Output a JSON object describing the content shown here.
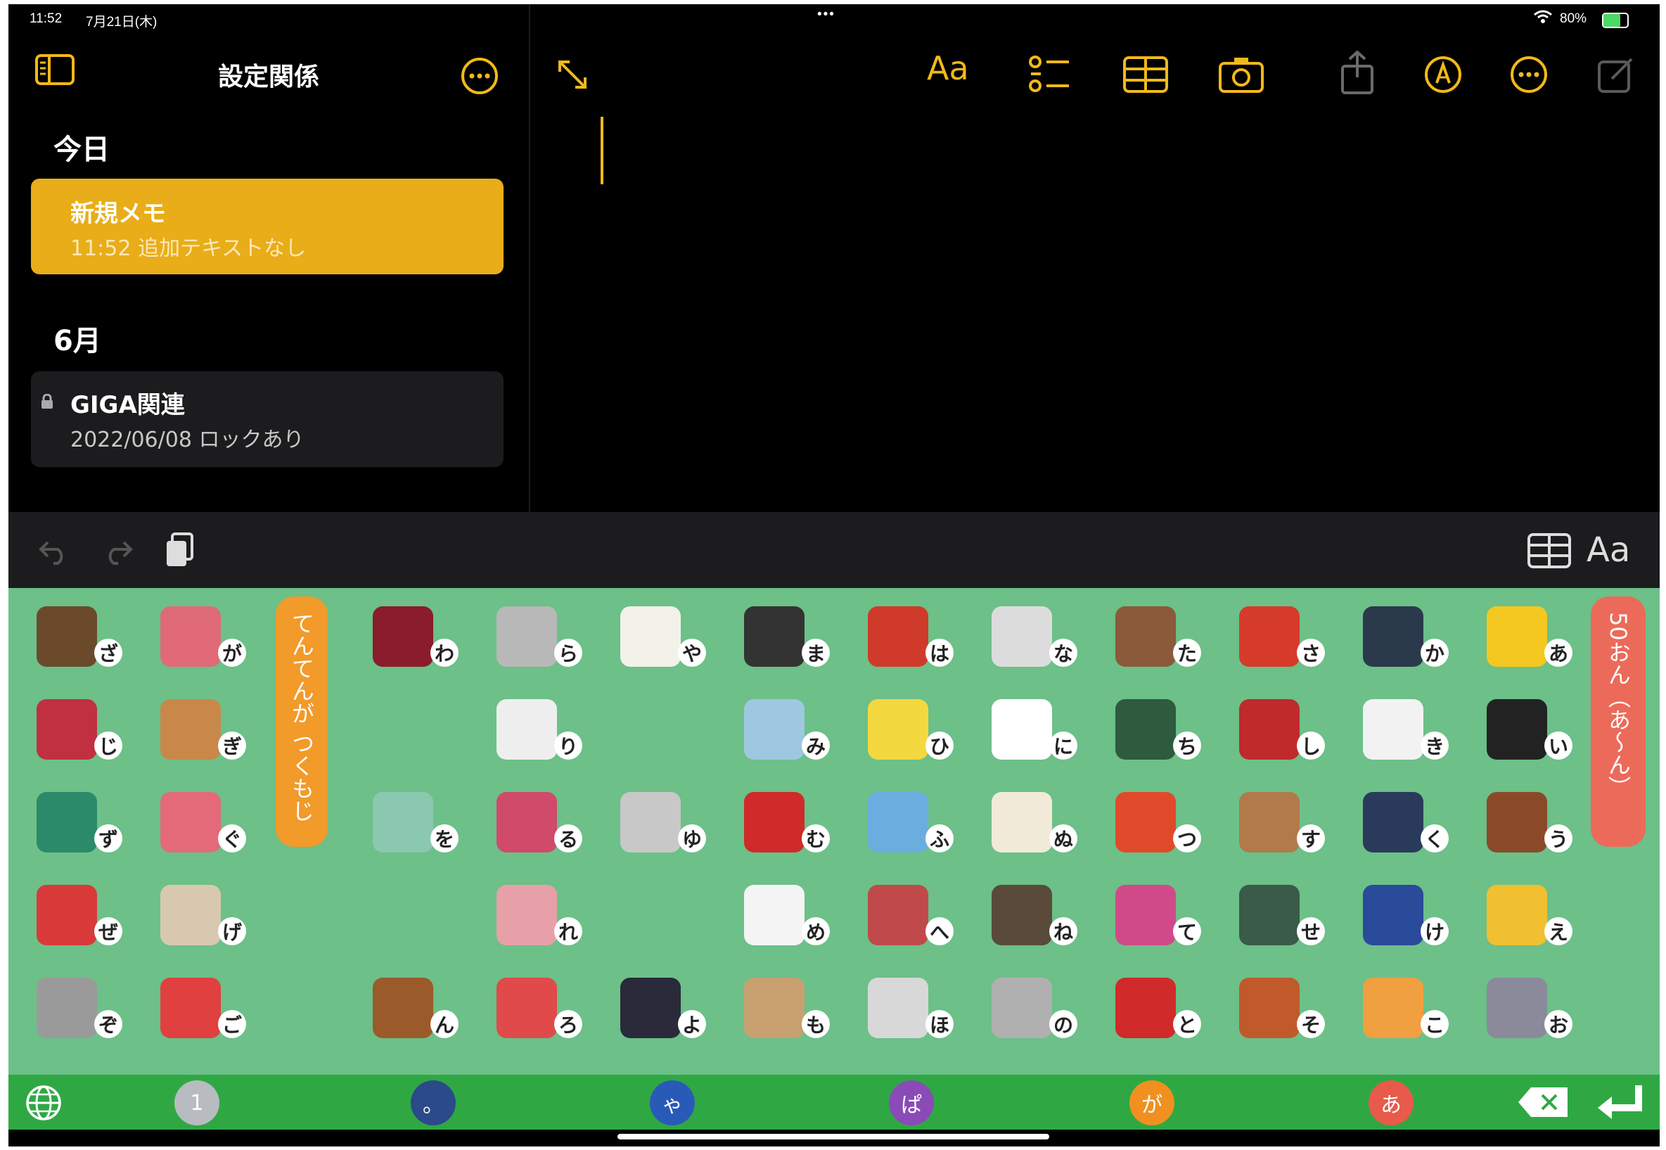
{
  "status": {
    "time": "11:52",
    "date": "7月21日(木)",
    "wifi": "wifi-icon",
    "battery": "80%"
  },
  "sidebar": {
    "title": "設定関係",
    "sections": [
      {
        "label": "今日",
        "notes": [
          {
            "title": "新規メモ",
            "subtitle": "11:52 追加テキストなし",
            "selected": true
          }
        ]
      },
      {
        "label": "6月",
        "notes": [
          {
            "title": "GIGA関連",
            "subtitle": "2022/06/08 ロックあり",
            "locked": true
          }
        ]
      }
    ]
  },
  "editor_toolbar": {
    "format_label": "Aa",
    "accent": "#f2b91a"
  },
  "input_toolbar": {
    "format_label": "Aa"
  },
  "keyboard": {
    "side_left": "てんてんが つくもじ",
    "side_right": "50おん（あ〜ん）",
    "bg": "#6cc088",
    "keys": [
      {
        "kana": "ざ",
        "pic": "rope-icon",
        "color": "#6b4a2c"
      },
      {
        "kana": "が",
        "pic": "purse-icon",
        "color": "#e06a78"
      },
      {
        "kana": "わ",
        "pic": "wine-icon",
        "color": "#8a1c2c"
      },
      {
        "kana": "ら",
        "pic": "robot-icon",
        "color": "#b8b8b8"
      },
      {
        "kana": "や",
        "pic": "goat-icon",
        "color": "#f2f2ea"
      },
      {
        "kana": "ま",
        "pic": "mic-icon",
        "color": "#333333"
      },
      {
        "kana": "は",
        "pic": "scissors-icon",
        "color": "#d03a2a"
      },
      {
        "kana": "な",
        "pic": "pot-icon",
        "color": "#dcdcdc"
      },
      {
        "kana": "た",
        "pic": "raccoon-icon",
        "color": "#8a5a3a"
      },
      {
        "kana": "さ",
        "pic": "santa-icon",
        "color": "#d63a2a"
      },
      {
        "kana": "か",
        "pic": "camera-icon",
        "color": "#2a3a4a"
      },
      {
        "kana": "あ",
        "pic": "duck-icon",
        "color": "#f4c820"
      },
      {
        "kana": "じ",
        "pic": "bicycle-icon",
        "color": "#c03040"
      },
      {
        "kana": "ぎ",
        "pic": "guitar-icon",
        "color": "#c8884a"
      },
      {
        "kana": "り",
        "pic": "airplane-icon",
        "color": "#eeeeee"
      },
      {
        "kana": "み",
        "pic": "faucet-icon",
        "color": "#9ec8e0"
      },
      {
        "kana": "ひ",
        "pic": "chick-icon",
        "color": "#f4d840"
      },
      {
        "kana": "に",
        "pic": "chicken-icon",
        "color": "#ffffff"
      },
      {
        "kana": "ち",
        "pic": "chalkboard-icon",
        "color": "#2e5a3e"
      },
      {
        "kana": "し",
        "pic": "train-icon",
        "color": "#c02a2a"
      },
      {
        "kana": "き",
        "pic": "ambulance-icon",
        "color": "#f2f2f2"
      },
      {
        "kana": "い",
        "pic": "dog-icon",
        "color": "#222222"
      },
      {
        "kana": "ず",
        "pic": "map-icon",
        "color": "#2a8a6a"
      },
      {
        "kana": "ぐ",
        "pic": "fish-icon",
        "color": "#e46a7a"
      },
      {
        "kana": "を",
        "pic": "painting-icon",
        "color": "#8ac8b0"
      },
      {
        "kana": "る",
        "pic": "gem-icon",
        "color": "#d04a6a"
      },
      {
        "kana": "ゆ",
        "pic": "ufo-icon",
        "color": "#c8c8c8"
      },
      {
        "kana": "む",
        "pic": "ladybug-icon",
        "color": "#d02a2a"
      },
      {
        "kana": "ふ",
        "pic": "flute-icon",
        "color": "#6aaee0"
      },
      {
        "kana": "ぬ",
        "pic": "embroidery-icon",
        "color": "#f2ead8"
      },
      {
        "kana": "つ",
        "pic": "blocks-icon",
        "color": "#e04a2a"
      },
      {
        "kana": "す",
        "pic": "shovel-icon",
        "color": "#b07a4a"
      },
      {
        "kana": "く",
        "pic": "shoe-icon",
        "color": "#2a3a5a"
      },
      {
        "kana": "う",
        "pic": "horse-icon",
        "color": "#8a4a2a"
      },
      {
        "kana": "ぜ",
        "pic": "car-icon",
        "color": "#d83a3a"
      },
      {
        "kana": "げ",
        "pic": "gamepad-icon",
        "color": "#d8c8b0"
      },
      {
        "kana": "れ",
        "pic": "mask-icon",
        "color": "#e8a0a8"
      },
      {
        "kana": "め",
        "pic": "envelope-icon",
        "color": "#f4f4f4"
      },
      {
        "kana": "へ",
        "pic": "headphones-icon",
        "color": "#c04a4a"
      },
      {
        "kana": "ね",
        "pic": "cat-icon",
        "color": "#5a4a3a"
      },
      {
        "kana": "て",
        "pic": "xylophone-icon",
        "color": "#d04a8a"
      },
      {
        "kana": "せ",
        "pic": "tape-icon",
        "color": "#3a5a4a"
      },
      {
        "kana": "け",
        "pic": "phone-icon",
        "color": "#2a4a9a"
      },
      {
        "kana": "え",
        "pic": "pencil-icon",
        "color": "#f0c030"
      },
      {
        "kana": "ぞ",
        "pic": "fridge-icon",
        "color": "#9a9a9a"
      },
      {
        "kana": "ご",
        "pic": "golf-icon",
        "color": "#e04040"
      },
      {
        "kana": "ん",
        "pic": "lion-icon",
        "color": "#9a5a2a"
      },
      {
        "kana": "ろ",
        "pic": "rocket-icon",
        "color": "#e04a4a"
      },
      {
        "kana": "よ",
        "pic": "helmet-icon",
        "color": "#2a2a3a"
      },
      {
        "kana": "も",
        "pic": "moai-icon",
        "color": "#c8a070"
      },
      {
        "kana": "ほ",
        "pic": "knife-icon",
        "color": "#d8d8d8"
      },
      {
        "kana": "の",
        "pic": "saw-icon",
        "color": "#b0b0b0"
      },
      {
        "kana": "と",
        "pic": "clock-icon",
        "color": "#d02a2a"
      },
      {
        "kana": "そ",
        "pic": "soba-icon",
        "color": "#c05a2a"
      },
      {
        "kana": "こ",
        "pic": "juice-icon",
        "color": "#f0a040"
      },
      {
        "kana": "お",
        "pic": "wolf-icon",
        "color": "#8a8a9a"
      }
    ]
  },
  "bottom_bar": {
    "buttons": [
      {
        "label": "1",
        "color": "#b8bcc0"
      },
      {
        "label": "。",
        "color": "#2a4a8a"
      },
      {
        "label": "ゃ",
        "color": "#2a5ab8"
      },
      {
        "label": "ぱ",
        "color": "#8a4ab8"
      },
      {
        "label": "が",
        "color": "#f09020"
      },
      {
        "label": "あ",
        "color": "#e85a4a"
      }
    ]
  }
}
